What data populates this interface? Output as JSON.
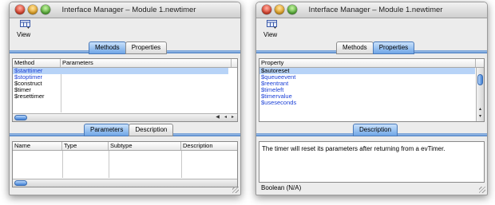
{
  "left_window": {
    "title": "Interface Manager – Module 1.newtimer",
    "toolbar": {
      "view_label": "View"
    },
    "tabs": [
      "Methods",
      "Properties"
    ],
    "active_tab": "Methods",
    "methods_table": {
      "columns": [
        "Method",
        "Parameters"
      ],
      "rows": [
        {
          "method": "$starttimer",
          "selected": true,
          "blue": true
        },
        {
          "method": "$stoptimer",
          "blue": true
        },
        {
          "method": "$construct"
        },
        {
          "method": "$timer"
        },
        {
          "method": "$resettimer"
        }
      ]
    },
    "subtabs": [
      "Parameters",
      "Description"
    ],
    "active_subtab": "Parameters",
    "parameters_table": {
      "columns": [
        "Name",
        "Type",
        "Subtype",
        "Description"
      ]
    }
  },
  "right_window": {
    "title": "Interface Manager – Module 1.newtimer",
    "toolbar": {
      "view_label": "View"
    },
    "tabs": [
      "Methods",
      "Properties"
    ],
    "active_tab": "Properties",
    "properties_table": {
      "columns": [
        "Property"
      ],
      "rows": [
        {
          "name": "$autoreset",
          "selected": true
        },
        {
          "name": "$queueevent",
          "blue": true
        },
        {
          "name": "$reentrant",
          "blue": true
        },
        {
          "name": "$timeleft",
          "blue": true
        },
        {
          "name": "$timervalue",
          "blue": true
        },
        {
          "name": "$useseconds",
          "blue": true
        }
      ]
    },
    "subtabs": [
      "Description"
    ],
    "active_subtab": "Description",
    "description_text": "The timer will reset its parameters after returning from a evTimer.",
    "status_text": "Boolean (N/A)"
  },
  "colors": {
    "accent_blue": "#6fa6e7",
    "selection": "#b7d3f7",
    "link_blue": "#1a3fd6"
  },
  "icons": [
    "close-icon",
    "minimize-icon",
    "zoom-icon",
    "view-icon",
    "resize-grip-icon"
  ]
}
